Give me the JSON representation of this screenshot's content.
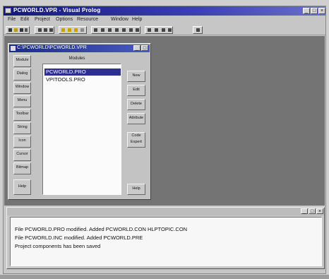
{
  "app": {
    "title": "PCWORLD.VPR - Visual Prolog",
    "window_buttons": [
      "_",
      "□",
      "×"
    ]
  },
  "menu": [
    "File",
    "Edit",
    "Project",
    "Options",
    "Resource",
    "Window",
    "Help"
  ],
  "project_window": {
    "title": "C:\\PCWORLD\\PCWORLD.VPR",
    "side_buttons": [
      "Module",
      "Dialog",
      "Window",
      "Menu",
      "Toolbar",
      "String",
      "Icon",
      "Cursor",
      "Bitmap",
      "Help"
    ],
    "list_label": "Modules",
    "modules": [
      "PCWORLD.PRO",
      "VPITOOLS.PRO"
    ],
    "selected_index": 0,
    "right_buttons": [
      "New",
      "Edit",
      "Delete",
      "Attribute",
      "Code Expert"
    ],
    "help_button": "Help"
  },
  "messages": {
    "lines": [
      "File PCWORLD.PRO modified. Added PCWORLD.CON HLPTOPIC.CON",
      "File PCWORLD.INC modified. Added PCWORLD.PRE",
      "Project components has been saved"
    ]
  },
  "colors": {
    "title_active": "#14187a",
    "workspace": "#747474",
    "selection": "#2d2f8c"
  }
}
